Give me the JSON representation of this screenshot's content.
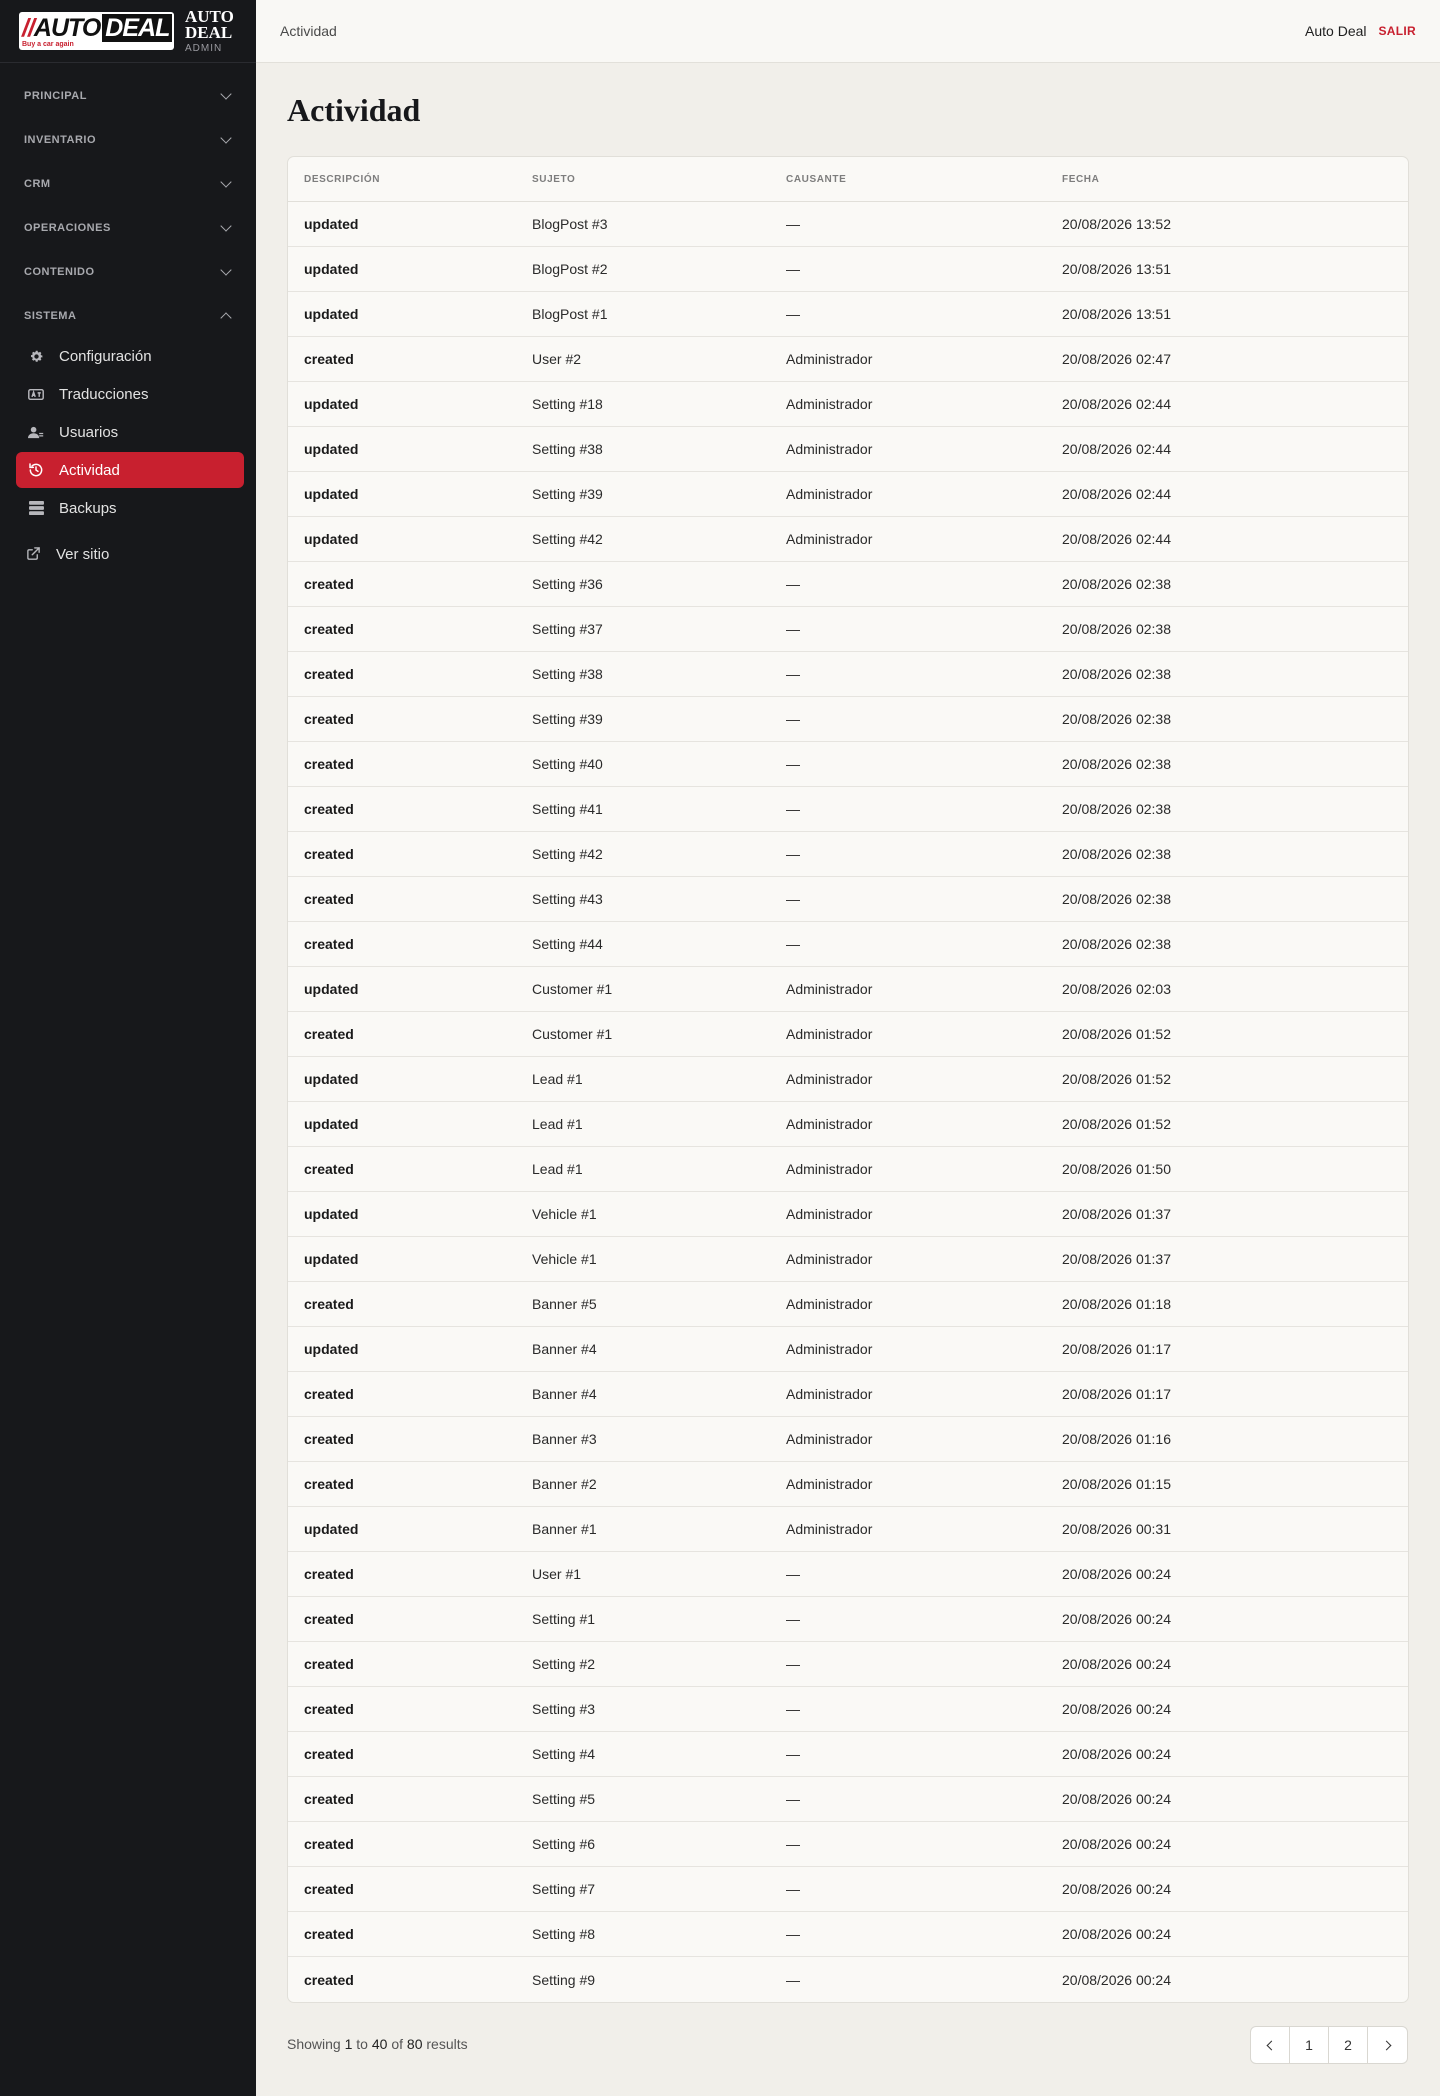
{
  "brand": {
    "logo_text_slash": "//",
    "logo_text_auto": "AUTO",
    "logo_text_deal": "DEAL",
    "logo_tagline": "Buy a car again",
    "title_line1": "AUTO",
    "title_line2": "DEAL",
    "subtitle": "ADMIN"
  },
  "sidebar": {
    "sections": [
      {
        "label": "PRINCIPAL",
        "expanded": false
      },
      {
        "label": "INVENTARIO",
        "expanded": false
      },
      {
        "label": "CRM",
        "expanded": false
      },
      {
        "label": "OPERACIONES",
        "expanded": false
      },
      {
        "label": "CONTENIDO",
        "expanded": false
      },
      {
        "label": "SISTEMA",
        "expanded": true
      }
    ],
    "items": [
      {
        "label": "Configuración",
        "icon": "gear-icon"
      },
      {
        "label": "Traducciones",
        "icon": "translate-icon"
      },
      {
        "label": "Usuarios",
        "icon": "users-icon"
      },
      {
        "label": "Actividad",
        "icon": "history-icon",
        "active": true
      },
      {
        "label": "Backups",
        "icon": "database-icon"
      }
    ],
    "external": {
      "label": "Ver sitio",
      "icon": "external-link-icon"
    }
  },
  "topbar": {
    "breadcrumb": "Actividad",
    "user_name": "Auto Deal",
    "logout_label": "SALIR"
  },
  "page": {
    "title": "Actividad"
  },
  "table": {
    "headers": [
      "DESCRIPCIÓN",
      "SUJETO",
      "CAUSANTE",
      "FECHA"
    ],
    "rows": [
      [
        "updated",
        "BlogPost #3",
        "—",
        "20/08/2026 13:52"
      ],
      [
        "updated",
        "BlogPost #2",
        "—",
        "20/08/2026 13:51"
      ],
      [
        "updated",
        "BlogPost #1",
        "—",
        "20/08/2026 13:51"
      ],
      [
        "created",
        "User #2",
        "Administrador",
        "20/08/2026 02:47"
      ],
      [
        "updated",
        "Setting #18",
        "Administrador",
        "20/08/2026 02:44"
      ],
      [
        "updated",
        "Setting #38",
        "Administrador",
        "20/08/2026 02:44"
      ],
      [
        "updated",
        "Setting #39",
        "Administrador",
        "20/08/2026 02:44"
      ],
      [
        "updated",
        "Setting #42",
        "Administrador",
        "20/08/2026 02:44"
      ],
      [
        "created",
        "Setting #36",
        "—",
        "20/08/2026 02:38"
      ],
      [
        "created",
        "Setting #37",
        "—",
        "20/08/2026 02:38"
      ],
      [
        "created",
        "Setting #38",
        "—",
        "20/08/2026 02:38"
      ],
      [
        "created",
        "Setting #39",
        "—",
        "20/08/2026 02:38"
      ],
      [
        "created",
        "Setting #40",
        "—",
        "20/08/2026 02:38"
      ],
      [
        "created",
        "Setting #41",
        "—",
        "20/08/2026 02:38"
      ],
      [
        "created",
        "Setting #42",
        "—",
        "20/08/2026 02:38"
      ],
      [
        "created",
        "Setting #43",
        "—",
        "20/08/2026 02:38"
      ],
      [
        "created",
        "Setting #44",
        "—",
        "20/08/2026 02:38"
      ],
      [
        "updated",
        "Customer #1",
        "Administrador",
        "20/08/2026 02:03"
      ],
      [
        "created",
        "Customer #1",
        "Administrador",
        "20/08/2026 01:52"
      ],
      [
        "updated",
        "Lead #1",
        "Administrador",
        "20/08/2026 01:52"
      ],
      [
        "updated",
        "Lead #1",
        "Administrador",
        "20/08/2026 01:52"
      ],
      [
        "created",
        "Lead #1",
        "Administrador",
        "20/08/2026 01:50"
      ],
      [
        "updated",
        "Vehicle #1",
        "Administrador",
        "20/08/2026 01:37"
      ],
      [
        "updated",
        "Vehicle #1",
        "Administrador",
        "20/08/2026 01:37"
      ],
      [
        "created",
        "Banner #5",
        "Administrador",
        "20/08/2026 01:18"
      ],
      [
        "updated",
        "Banner #4",
        "Administrador",
        "20/08/2026 01:17"
      ],
      [
        "created",
        "Banner #4",
        "Administrador",
        "20/08/2026 01:17"
      ],
      [
        "created",
        "Banner #3",
        "Administrador",
        "20/08/2026 01:16"
      ],
      [
        "created",
        "Banner #2",
        "Administrador",
        "20/08/2026 01:15"
      ],
      [
        "updated",
        "Banner #1",
        "Administrador",
        "20/08/2026 00:31"
      ],
      [
        "created",
        "User #1",
        "—",
        "20/08/2026 00:24"
      ],
      [
        "created",
        "Setting #1",
        "—",
        "20/08/2026 00:24"
      ],
      [
        "created",
        "Setting #2",
        "—",
        "20/08/2026 00:24"
      ],
      [
        "created",
        "Setting #3",
        "—",
        "20/08/2026 00:24"
      ],
      [
        "created",
        "Setting #4",
        "—",
        "20/08/2026 00:24"
      ],
      [
        "created",
        "Setting #5",
        "—",
        "20/08/2026 00:24"
      ],
      [
        "created",
        "Setting #6",
        "—",
        "20/08/2026 00:24"
      ],
      [
        "created",
        "Setting #7",
        "—",
        "20/08/2026 00:24"
      ],
      [
        "created",
        "Setting #8",
        "—",
        "20/08/2026 00:24"
      ],
      [
        "created",
        "Setting #9",
        "—",
        "20/08/2026 00:24"
      ]
    ]
  },
  "pagination": {
    "showing_prefix": "Showing",
    "from": "1",
    "to_word": "to",
    "to": "40",
    "of_word": "of",
    "total": "80",
    "results_word": "results",
    "pages": [
      "1",
      "2"
    ],
    "current_page": "1"
  },
  "colors": {
    "accent": "#c8202f",
    "sidebar_bg": "#17181b",
    "page_bg": "#f1efea"
  }
}
